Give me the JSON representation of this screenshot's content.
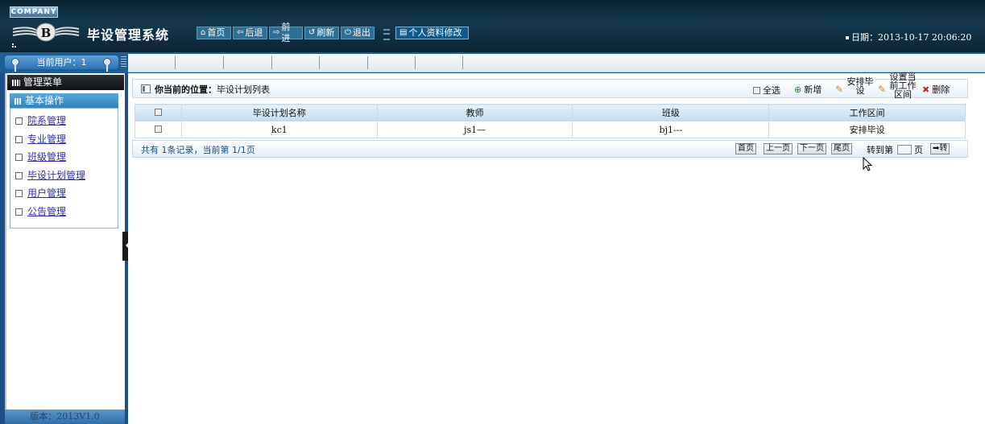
{
  "header": {
    "company": "COMPANY",
    "title": "毕设管理系统",
    "toolbar": [
      {
        "label": "首页",
        "icon": "home-icon",
        "glyph": "⌂"
      },
      {
        "label": "后退",
        "icon": "arrow-left-icon",
        "glyph": "⇦"
      },
      {
        "label": "前进",
        "icon": "arrow-right-icon",
        "glyph": "⇨"
      },
      {
        "label": "刷新",
        "icon": "refresh-icon",
        "glyph": "↺"
      },
      {
        "label": "退出",
        "icon": "power-icon",
        "glyph": "⏻"
      }
    ],
    "profile_button": "个人资料修改",
    "date": "日期：2013-10-17 20:06:20"
  },
  "subbar": {
    "current_user": "当前用户：1"
  },
  "sidebar": {
    "menu_title": "管理菜单",
    "section_title": "基本操作",
    "items": [
      "院系管理",
      "专业管理",
      "班级管理",
      "毕设计划管理",
      "用户管理",
      "公告管理"
    ],
    "version": "版本：2013V1.0"
  },
  "location": {
    "prefix": "你当前的位置：",
    "page": "毕设计划列表"
  },
  "actions": {
    "select_all": "全选",
    "add": "新增",
    "arrange_line1": "安排毕",
    "arrange_line2": "设",
    "set_line1": "设置当",
    "set_line2": "前工作",
    "set_line3": "区间",
    "delete": "删除"
  },
  "table": {
    "headers": [
      "毕设计划名称",
      "教师",
      "班级",
      "工作区间"
    ],
    "rows": [
      [
        "kc1",
        "js1—",
        "bj1---",
        "安排毕设"
      ]
    ]
  },
  "pager": {
    "summary": "共有 1条记录，当前第 1/1页",
    "first": "首页",
    "prev": "上一页",
    "next": "下一页",
    "last": "尾页",
    "goto_label": "转到第",
    "page_unit": "页",
    "go": "转"
  },
  "colors": {
    "header_bg": "#14394e",
    "accent_blue": "#2f83c2",
    "link": "#3030a8"
  }
}
